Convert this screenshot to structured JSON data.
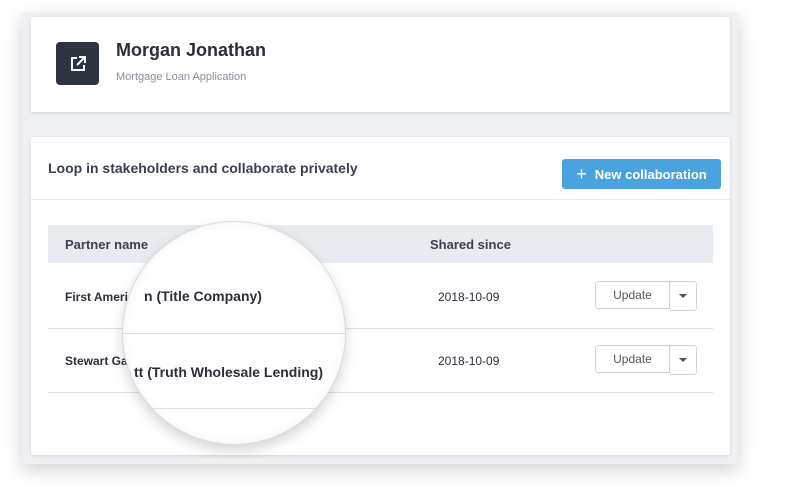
{
  "header": {
    "title": "Morgan Jonathan",
    "subtitle": "Mortgage Loan Application",
    "icon": "external-link-icon"
  },
  "collaboration": {
    "section_title": "Loop in stakeholders and collaborate privately",
    "new_button_label": "New collaboration",
    "new_button_color": "#4aa3df"
  },
  "table": {
    "columns": [
      "Partner name",
      "Shared since"
    ],
    "rows": [
      {
        "name": "First America",
        "date": "2018-10-09",
        "action": "Update"
      },
      {
        "name": "Stewart Gar",
        "date": "2018-10-09",
        "action": "Update"
      }
    ]
  },
  "magnifier": {
    "lines": [
      "n (Title Company)",
      "tt (Truth Wholesale Lending)"
    ]
  }
}
